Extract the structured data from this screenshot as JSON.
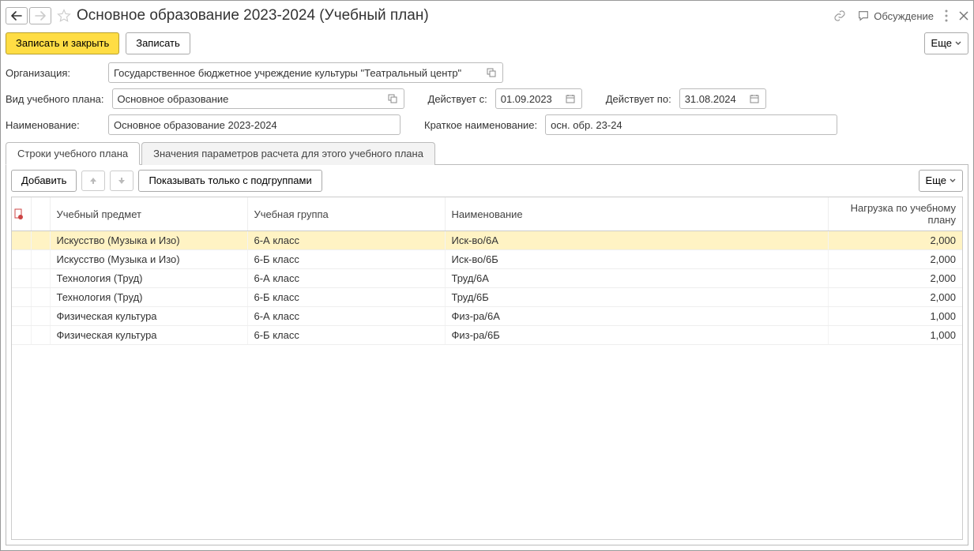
{
  "title": "Основное образование 2023-2024 (Учебный план)",
  "header": {
    "discuss_label": "Обсуждение"
  },
  "toolbar": {
    "save_close": "Записать и закрыть",
    "save": "Записать",
    "more": "Еще"
  },
  "form": {
    "org_label": "Организация:",
    "org_value": "Государственное бюджетное учреждение культуры \"Театральный центр\"",
    "plan_type_label": "Вид учебного плана:",
    "plan_type_value": "Основное образование",
    "valid_from_label": "Действует с:",
    "valid_from_value": "01.09.2023",
    "valid_to_label": "Действует по:",
    "valid_to_value": "31.08.2024",
    "name_label": "Наименование:",
    "name_value": "Основное образование 2023-2024",
    "short_name_label": "Краткое наименование:",
    "short_name_value": "осн. обр. 23-24"
  },
  "tabs": {
    "rows": "Строки учебного плана",
    "params": "Значения параметров расчета для этого учебного плана"
  },
  "grid_toolbar": {
    "add": "Добавить",
    "filter_subgroups": "Показывать только с подгруппами",
    "more": "Еще"
  },
  "grid": {
    "columns": {
      "subject": "Учебный предмет",
      "group": "Учебная группа",
      "name": "Наименование",
      "load": "Нагрузка по учебному плану"
    },
    "rows": [
      {
        "subject": "Искусство (Музыка и Изо)",
        "group": "6-А класс",
        "name": "Иск-во/6А",
        "load": "2,000",
        "selected": true
      },
      {
        "subject": "Искусство (Музыка и Изо)",
        "group": "6-Б класс",
        "name": "Иск-во/6Б",
        "load": "2,000"
      },
      {
        "subject": "Технология (Труд)",
        "group": "6-А класс",
        "name": "Труд/6А",
        "load": "2,000"
      },
      {
        "subject": "Технология (Труд)",
        "group": "6-Б класс",
        "name": "Труд/6Б",
        "load": "2,000"
      },
      {
        "subject": "Физическая культура",
        "group": "6-А класс",
        "name": "Физ-ра/6А",
        "load": "1,000"
      },
      {
        "subject": "Физическая культура",
        "group": "6-Б класс",
        "name": "Физ-ра/6Б",
        "load": "1,000"
      }
    ]
  }
}
